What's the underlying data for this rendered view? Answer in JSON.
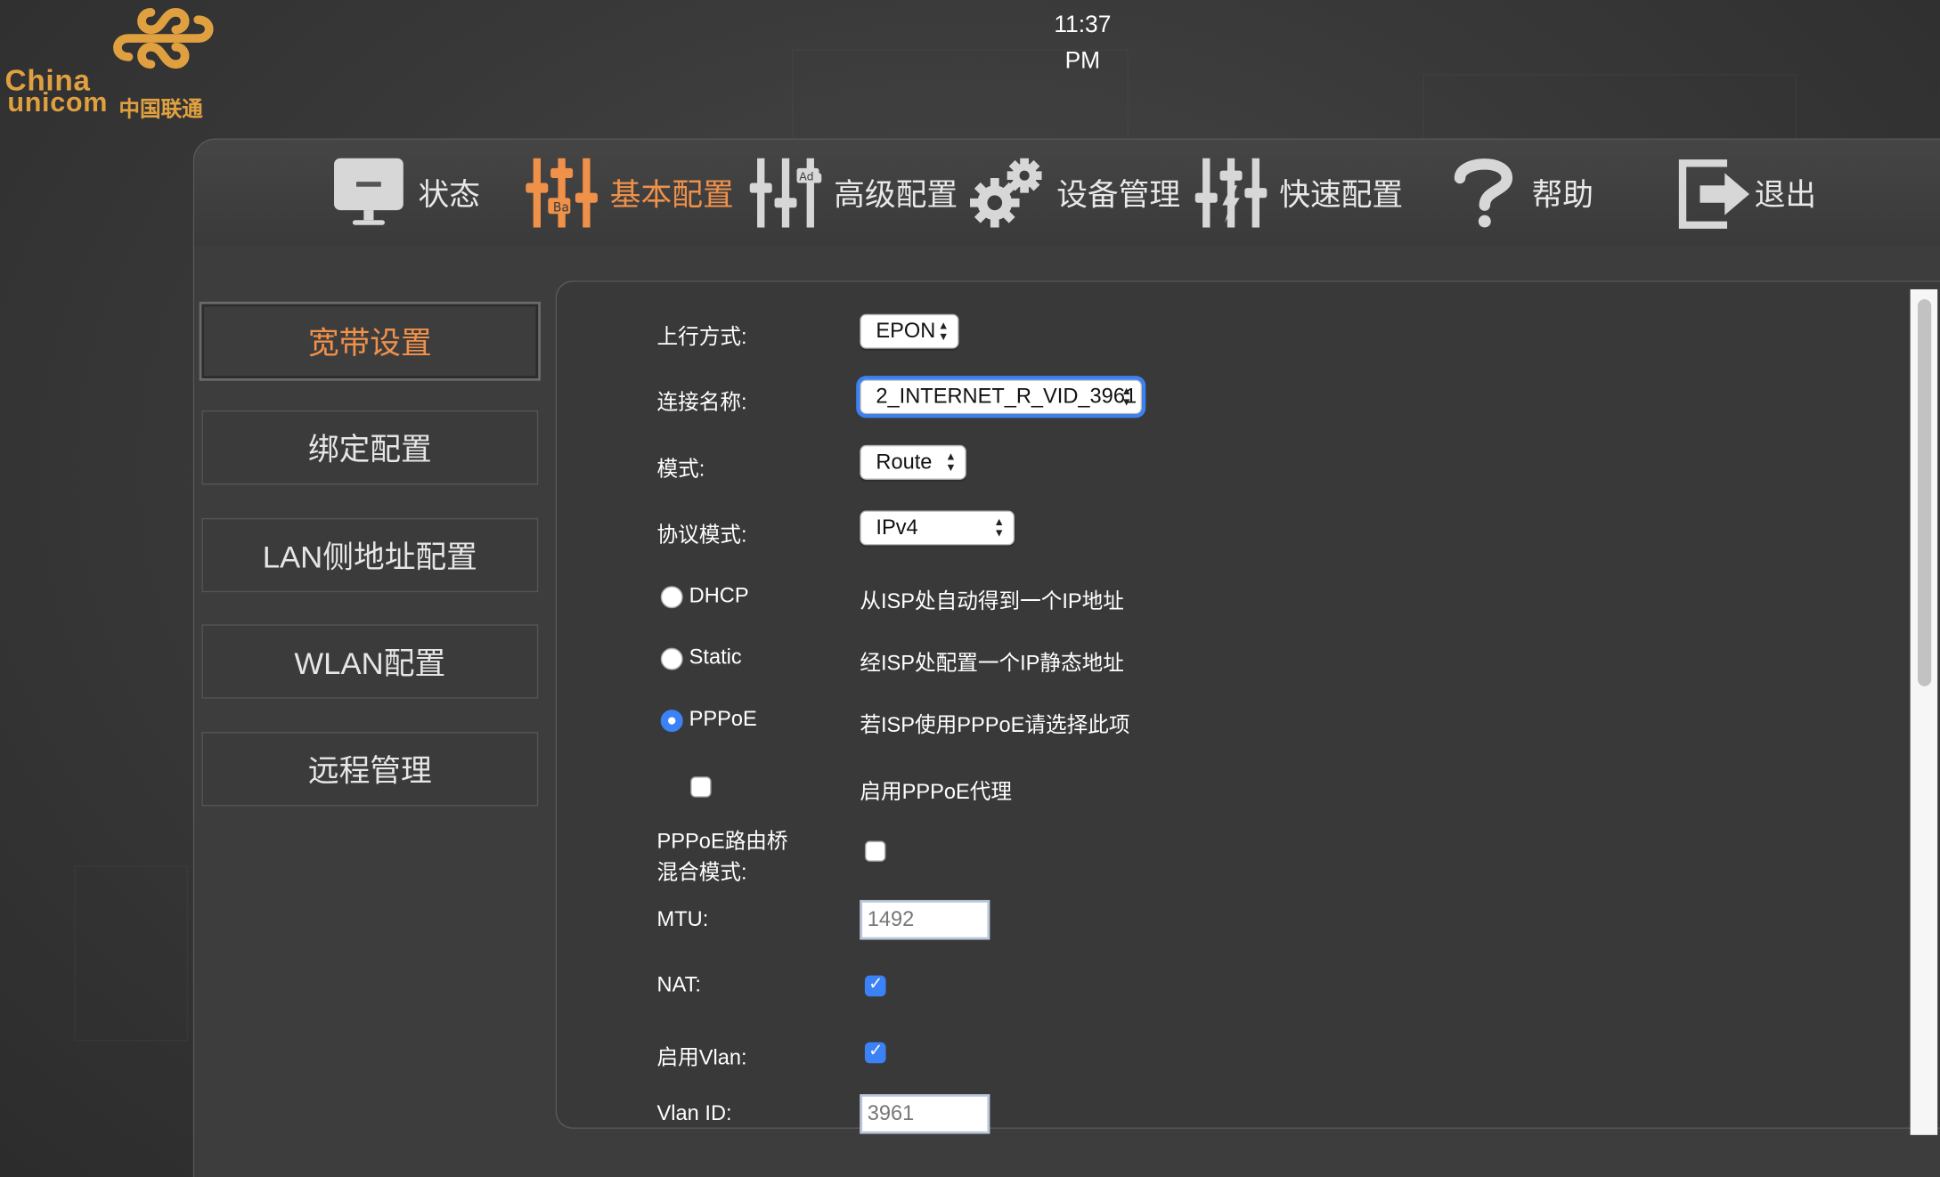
{
  "brand": {
    "logo_en_1": "China",
    "logo_en_2": "unicom",
    "logo_cn": "中国联通"
  },
  "clock": {
    "time": "11:37",
    "ampm": "PM"
  },
  "nav": [
    {
      "label": "状态",
      "icon": "monitor-icon"
    },
    {
      "label": "基本配置",
      "icon": "basic-sliders-icon",
      "active": true
    },
    {
      "label": "高级配置",
      "icon": "advanced-sliders-icon"
    },
    {
      "label": "设备管理",
      "icon": "gears-icon"
    },
    {
      "label": "快速配置",
      "icon": "quick-sliders-icon"
    },
    {
      "label": "帮助",
      "icon": "question-icon"
    },
    {
      "label": "退出",
      "icon": "logout-icon"
    }
  ],
  "sidebar": [
    {
      "label": "宽带设置",
      "active": true
    },
    {
      "label": "绑定配置"
    },
    {
      "label": "LAN侧地址配置"
    },
    {
      "label": "WLAN配置"
    },
    {
      "label": "远程管理"
    }
  ],
  "form": {
    "uplink": {
      "label": "上行方式:",
      "value": "EPON"
    },
    "conn_name": {
      "label": "连接名称:",
      "value": "2_INTERNET_R_VID_3961"
    },
    "mode": {
      "label": "模式:",
      "value": "Route"
    },
    "protocol": {
      "label": "协议模式:",
      "value": "IPv4"
    },
    "dhcp": {
      "label": "DHCP",
      "desc": "从ISP处自动得到一个IP地址",
      "checked": false
    },
    "static": {
      "label": "Static",
      "desc": "经ISP处配置一个IP静态地址",
      "checked": false
    },
    "pppoe": {
      "label": "PPPoE",
      "desc": "若ISP使用PPPoE请选择此项",
      "checked": true
    },
    "pppoe_proxy": {
      "label": "启用PPPoE代理",
      "checked": false
    },
    "pppoe_bridge": {
      "label_1": "PPPoE路由桥",
      "label_2": "混合模式:",
      "checked": false
    },
    "mtu": {
      "label": "MTU:",
      "value": "1492"
    },
    "nat": {
      "label": "NAT:",
      "checked": true
    },
    "vlan_enable": {
      "label": "启用Vlan:",
      "checked": true
    },
    "vlan_id": {
      "label": "Vlan ID:",
      "value": "3961"
    }
  },
  "colors": {
    "accent": "#f0914a",
    "focus": "#3b82f6",
    "logo": "#e0a040"
  }
}
